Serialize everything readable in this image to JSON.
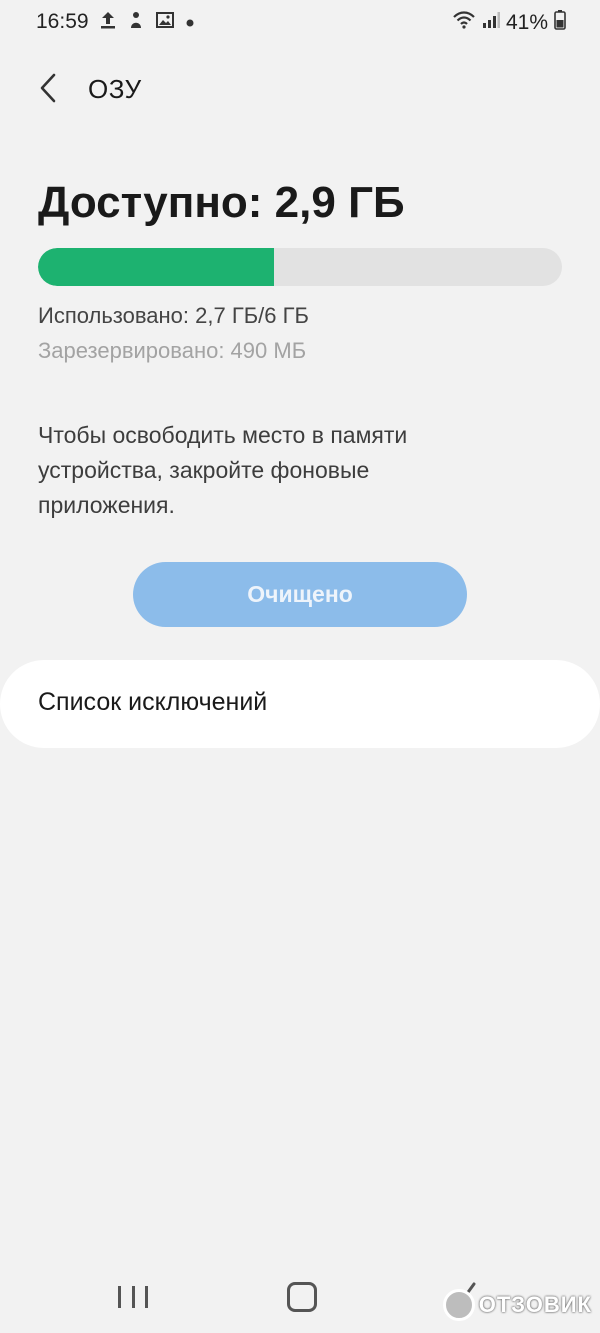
{
  "status_bar": {
    "time": "16:59",
    "icons": [
      "upload-icon",
      "person-icon",
      "image-icon",
      "dot-icon",
      "wifi-icon",
      "signal-icon",
      "battery-icon"
    ],
    "battery": "41%"
  },
  "header": {
    "title": "ОЗУ"
  },
  "memory": {
    "available": "Доступно: 2,9 ГБ",
    "used_fraction": 0.45,
    "used": "Использовано: 2,7 ГБ/6 ГБ",
    "reserved": "Зарезервировано: 490 МБ",
    "description": "Чтобы освободить место в памяти устройства, закройте фоновые приложения."
  },
  "actions": {
    "clean_label": "Очищено"
  },
  "exclusions": {
    "label": "Список исключений"
  },
  "watermark": {
    "text": "ОТЗОВИК"
  },
  "colors": {
    "accent_green": "#1db270",
    "button_blue": "#8cbcea",
    "background": "#f2f2f2"
  }
}
